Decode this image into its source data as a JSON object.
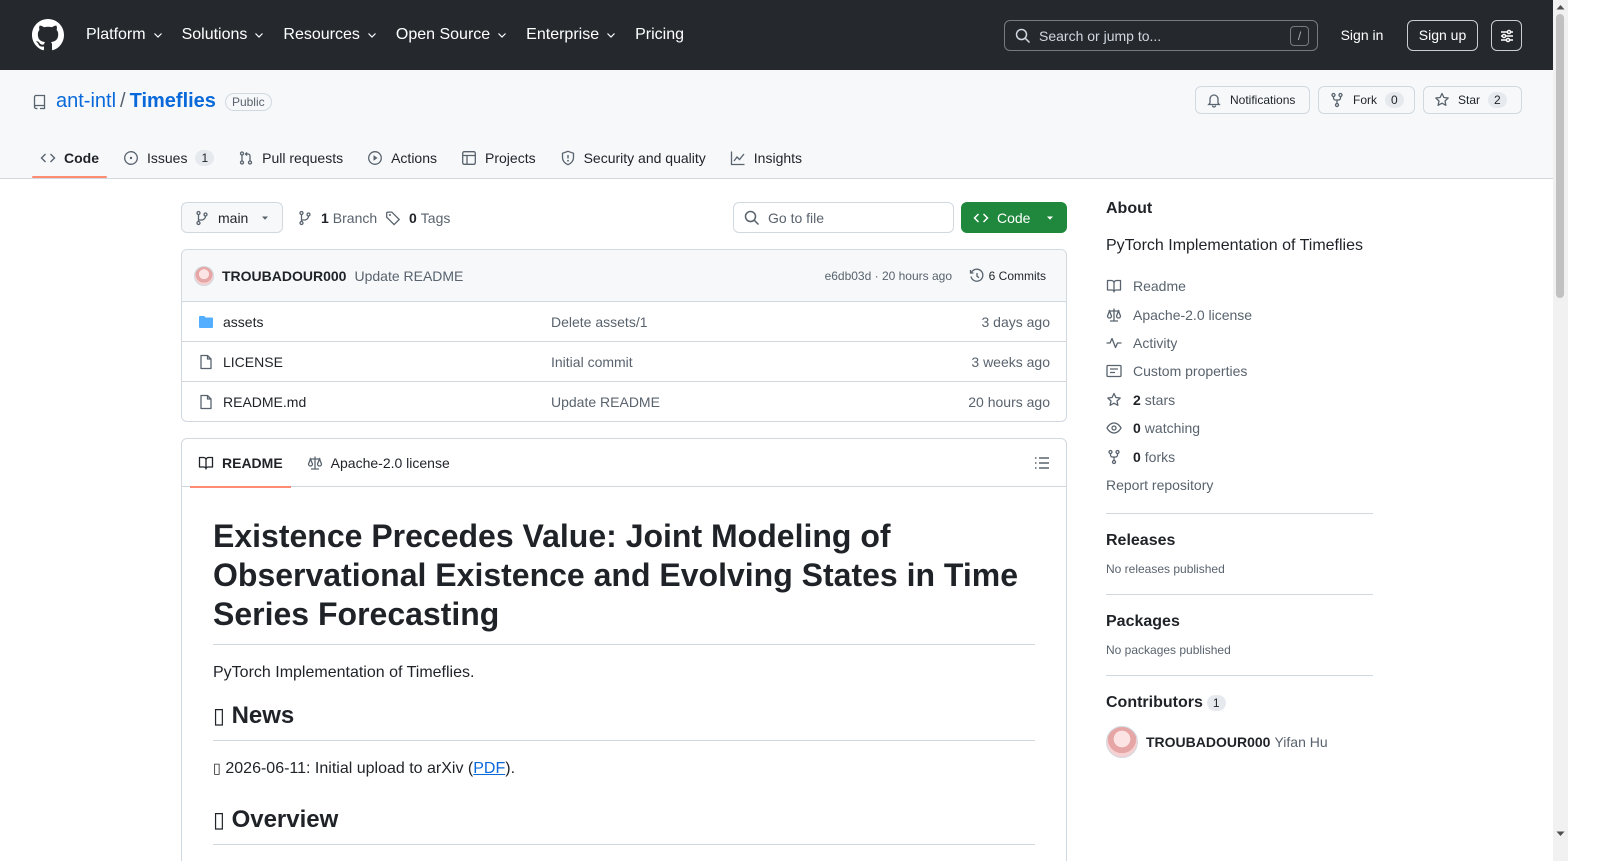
{
  "header": {
    "nav": [
      "Platform",
      "Solutions",
      "Resources",
      "Open Source",
      "Enterprise",
      "Pricing"
    ],
    "nav_has_chevron": [
      true,
      true,
      true,
      true,
      true,
      false
    ],
    "search_placeholder": "Search or jump to...",
    "search_shortcut": "/",
    "sign_in": "Sign in",
    "sign_up": "Sign up"
  },
  "repo": {
    "owner": "ant-intl",
    "separator": "/",
    "name": "Timeflies",
    "visibility": "Public",
    "notifications_label": "Notifications",
    "fork_label": "Fork",
    "fork_count": "0",
    "star_label": "Star",
    "star_count": "2"
  },
  "tabs": [
    {
      "label": "Code",
      "icon": "code-icon",
      "active": true
    },
    {
      "label": "Issues",
      "icon": "issue-icon",
      "count": "1"
    },
    {
      "label": "Pull requests",
      "icon": "pull-request-icon"
    },
    {
      "label": "Actions",
      "icon": "play-icon"
    },
    {
      "label": "Projects",
      "icon": "table-icon"
    },
    {
      "label": "Security and quality",
      "icon": "shield-icon"
    },
    {
      "label": "Insights",
      "icon": "graph-icon"
    }
  ],
  "toolbar": {
    "branch": "main",
    "branch_count": "1",
    "branch_label": "Branch",
    "tag_count": "0",
    "tag_label": "Tags",
    "goto_placeholder": "Go to file",
    "code_label": "Code"
  },
  "latest_commit": {
    "author": "TROUBADOUR000",
    "message": "Update README",
    "sha_time": "e6db03d · 20 hours ago",
    "commits": "6 Commits"
  },
  "files": [
    {
      "name": "assets",
      "type": "dir",
      "message": "Delete assets/1",
      "date": "3 days ago"
    },
    {
      "name": "LICENSE",
      "type": "file",
      "message": "Initial commit",
      "date": "3 weeks ago"
    },
    {
      "name": "README.md",
      "type": "file",
      "message": "Update README",
      "date": "20 hours ago"
    }
  ],
  "readme": {
    "tab_readme": "README",
    "tab_license": "Apache-2.0 license",
    "title": "Existence Precedes Value: Joint Modeling of Observational Existence and Evolving States in Time Series Forecasting",
    "intro": "PyTorch Implementation of Timeflies.",
    "news_heading": "News",
    "news_item_prefix": "2026-06-11: Initial upload to arXiv (",
    "news_item_link": "PDF",
    "news_item_suffix": ").",
    "overview_heading": "Overview"
  },
  "about": {
    "heading": "About",
    "description": "PyTorch Implementation of Timeflies",
    "readme": "Readme",
    "license": "Apache-2.0 license",
    "activity": "Activity",
    "custom_properties": "Custom properties",
    "stars_count": "2",
    "stars_label": "stars",
    "watching_count": "0",
    "watching_label": "watching",
    "forks_count": "0",
    "forks_label": "forks",
    "report": "Report repository"
  },
  "releases": {
    "heading": "Releases",
    "empty": "No releases published"
  },
  "packages": {
    "heading": "Packages",
    "empty": "No packages published"
  },
  "contributors": {
    "heading": "Contributors",
    "count": "1",
    "login": "TROUBADOUR000",
    "full_name": "Yifan Hu"
  },
  "colors": {
    "header_bg": "#25292e",
    "link": "#0969da",
    "primary_button": "#1f883d",
    "tab_underline": "#fd8c73"
  }
}
